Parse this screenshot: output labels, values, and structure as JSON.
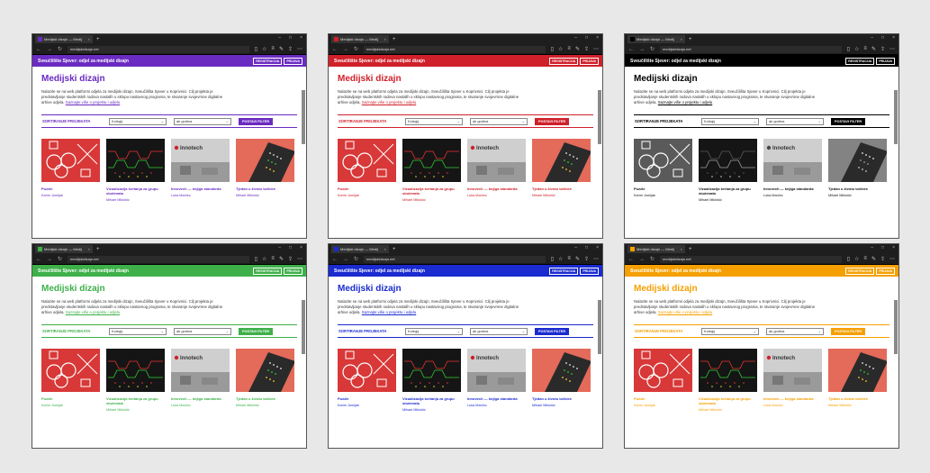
{
  "browser": {
    "tab_title": "Medijski dizajn — Medij",
    "tab_close": "×",
    "new_tab": "+",
    "url": "medijskidizajn.net",
    "nav_back": "←",
    "nav_forward": "→",
    "nav_refresh": "↻"
  },
  "site": {
    "name": "Sveučilište Sjever: odjel za medijski dizajn",
    "register_label": "REGISTRACIJA",
    "login_label": "PRIJAVA"
  },
  "page": {
    "title": "Medijski dizajn",
    "intro_text": "Nalazite se na web platformi odjela za medijski dizajn, Sveučilišta Sjever u Koprivnici. Cilj projekta je predstavljanje studentskih radova nastalih u sklopu nastavnog programa, te stvaranje svojevrsne digitalne arhive odjela.",
    "intro_link": "Saznajte više o projektu i odjelu"
  },
  "filter": {
    "label": "SORTIRANJE PROJEKATA",
    "category_value": "Kolegij",
    "year_value": "ak godina",
    "button_label": "POSTAVI FILTER"
  },
  "cards": [
    {
      "title": "Puzzle",
      "author": "Karim Jumijak"
    },
    {
      "title": "Vizualizacija kretanja za grupu studenata",
      "author": "Mihael Miklošić"
    },
    {
      "title": "Innovech — knjiga standarda",
      "author": "Luka Marčec"
    },
    {
      "title": "Tjedan u životu točkiće",
      "author": "Mihael Miklošić"
    }
  ],
  "innotech_logo": "Innotech",
  "themes": [
    {
      "name": "purple",
      "color": "#6a2bc1"
    },
    {
      "name": "red",
      "color": "#d0202a"
    },
    {
      "name": "black",
      "color": "#000000"
    },
    {
      "name": "green",
      "color": "#3eb04a"
    },
    {
      "name": "blue",
      "color": "#1a2bd0"
    },
    {
      "name": "orange",
      "color": "#f5a000"
    }
  ]
}
